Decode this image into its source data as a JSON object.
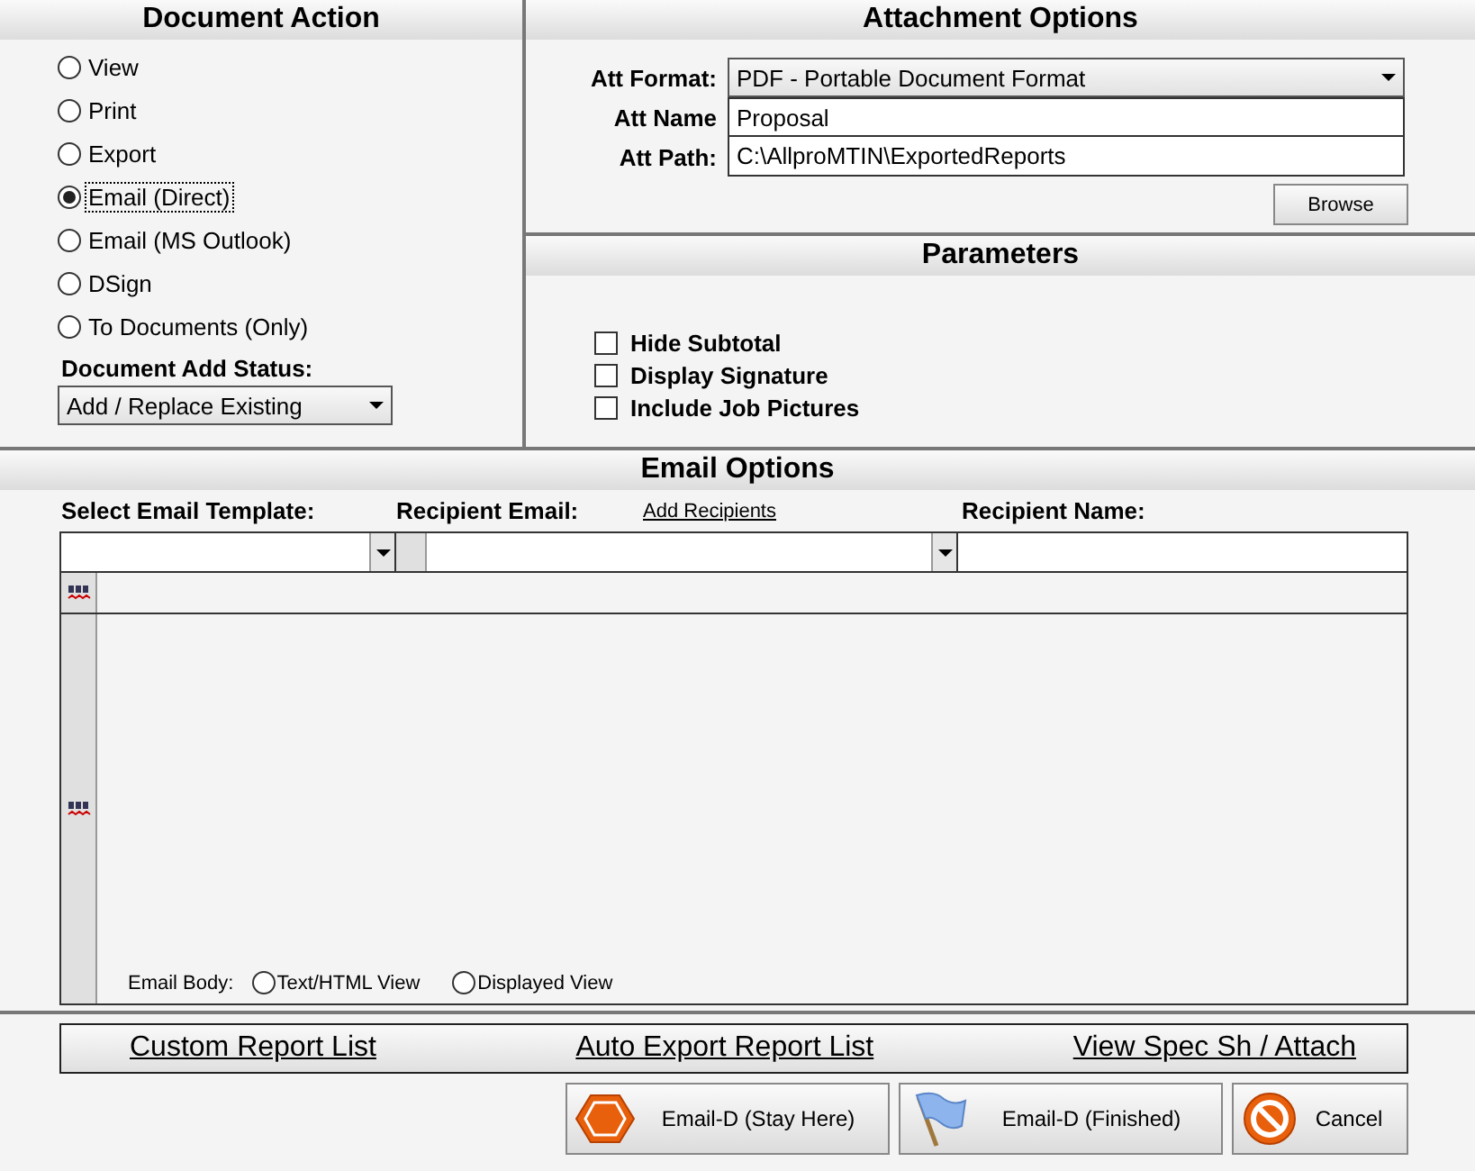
{
  "document_action": {
    "title": "Document Action",
    "options": [
      {
        "label": "View",
        "selected": false
      },
      {
        "label": "Print",
        "selected": false
      },
      {
        "label": "Export",
        "selected": false
      },
      {
        "label": "Email (Direct)",
        "selected": true
      },
      {
        "label": "Email (MS Outlook)",
        "selected": false
      },
      {
        "label": "DSign",
        "selected": false
      },
      {
        "label": "To Documents (Only)",
        "selected": false
      }
    ],
    "add_status_label": "Document Add Status:",
    "add_status_value": "Add / Replace Existing"
  },
  "attachment_options": {
    "title": "Attachment Options",
    "format_label": "Att Format:",
    "format_value": "PDF - Portable Document Format",
    "name_label": "Att Name",
    "name_value": "Proposal",
    "path_label": "Att Path:",
    "path_value": "C:\\AllproMTIN\\ExportedReports",
    "browse": "Browse"
  },
  "parameters": {
    "title": "Parameters",
    "items": [
      {
        "label": "Hide Subtotal",
        "checked": false
      },
      {
        "label": "Display Signature",
        "checked": false
      },
      {
        "label": "Include Job Pictures",
        "checked": false
      }
    ]
  },
  "email_options": {
    "title": "Email Options",
    "template_label": "Select Email Template:",
    "recipient_email_label": "Recipient Email:",
    "add_recipients": "Add Recipients",
    "recipient_name_label": "Recipient Name:",
    "body_label": "Email Body:",
    "body_views": [
      {
        "label": "Text/HTML View",
        "selected": false
      },
      {
        "label": "Displayed View",
        "selected": false
      }
    ]
  },
  "links": [
    "Custom Report List",
    "Auto Export Report List",
    "View Spec Sh / Attach"
  ],
  "buttons": [
    {
      "label": "Email-D (Stay Here)",
      "kind": "stop"
    },
    {
      "label": "Email-D (Finished)",
      "kind": "flag"
    },
    {
      "label": "Cancel",
      "kind": "cancel"
    }
  ]
}
